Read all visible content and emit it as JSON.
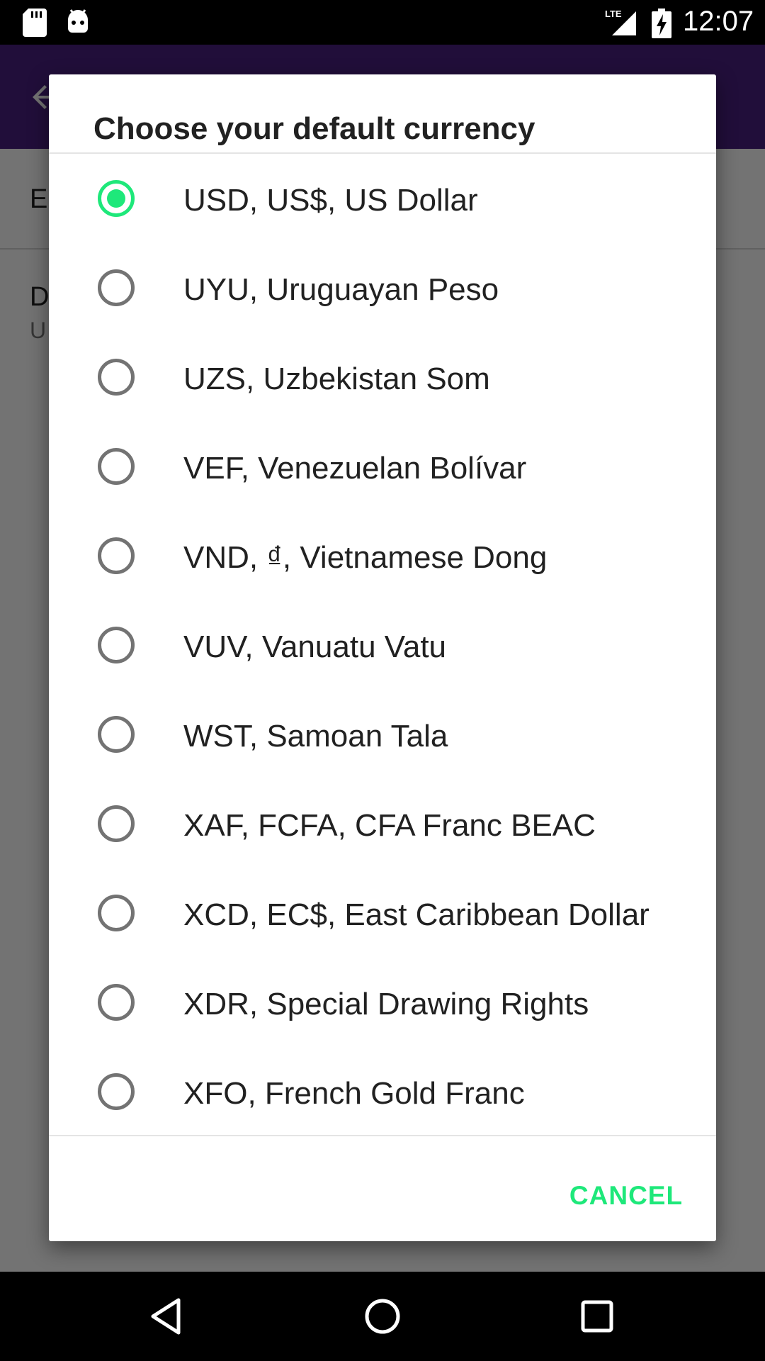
{
  "status_bar": {
    "time": "12:07",
    "network": "LTE",
    "icons": [
      "sd-card-icon",
      "android-debug-icon",
      "lte-signal-icon",
      "battery-charging-icon"
    ]
  },
  "app": {
    "pref_1_title_fragment": "E",
    "pref_2_title_fragment": "D",
    "pref_2_summary_fragment": "U"
  },
  "dialog": {
    "title": "Choose your default currency",
    "selected_index": 0,
    "options": [
      "USD, US$, US Dollar",
      "UYU, Uruguayan Peso",
      "UZS, Uzbekistan Som",
      "VEF, Venezuelan Bolívar",
      "VND, ₫, Vietnamese Dong",
      "VUV, Vanuatu Vatu",
      "WST, Samoan Tala",
      "XAF, FCFA, CFA Franc BEAC",
      "XCD, EC$, East Caribbean Dollar",
      "XDR, Special Drawing Rights",
      "XFO, French Gold Franc"
    ],
    "cancel_label": "CANCEL"
  },
  "colors": {
    "accent": "#1ee87a",
    "toolbar": "#4a1f82"
  }
}
